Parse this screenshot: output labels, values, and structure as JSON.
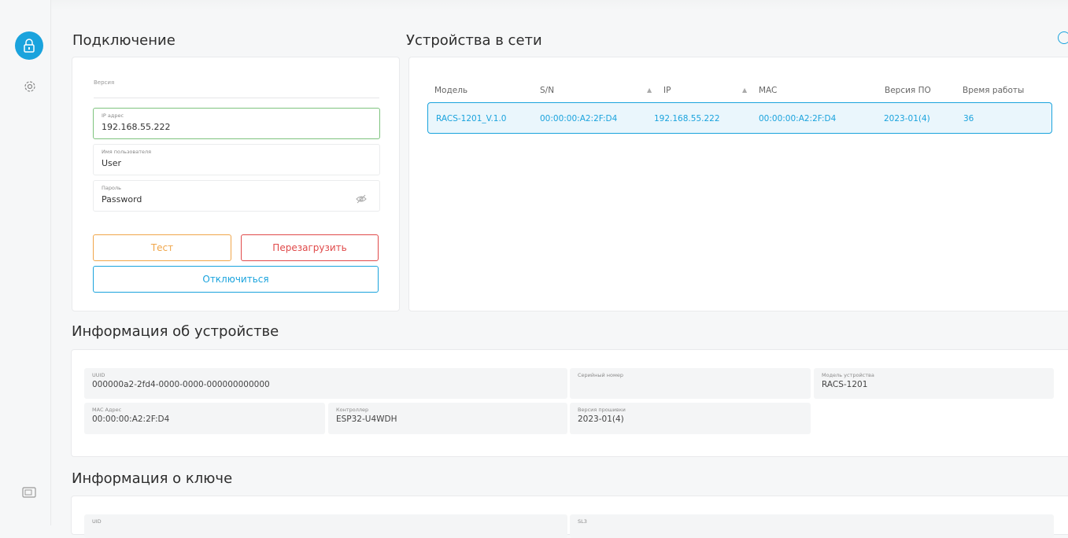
{
  "connection": {
    "title": "Подключение",
    "version_label": "Версия",
    "ip_label": "IP адрес",
    "ip_value": "192.168.55.222",
    "user_label": "Имя пользователя",
    "user_value": "User",
    "password_label": "Пароль",
    "password_value": "Password",
    "test_button": "Тест",
    "reboot_button": "Перезагрузить",
    "disconnect_button": "Отключиться"
  },
  "devices": {
    "title": "Устройства в сети",
    "columns": [
      "Модель",
      "S/N",
      "IP",
      "MAC",
      "Версия ПО",
      "Время работы"
    ],
    "rows": [
      [
        "RACS-1201_V.1.0",
        "00:00:00:A2:2F:D4",
        "192.168.55.222",
        "00:00:00:A2:2F:D4",
        "2023-01(4)",
        "36"
      ]
    ]
  },
  "device_info": {
    "title": "Информация об устройстве",
    "uuid_label": "UUID",
    "uuid_value": "000000a2-2fd4-0000-0000-000000000000",
    "serial_label": "Серийный номер",
    "serial_value": "",
    "model_label": "Модель устройства",
    "model_value": "RACS-1201",
    "mac_label": "MAC Адрес",
    "mac_value": "00:00:00:A2:2F:D4",
    "controller_label": "Контроллер",
    "controller_value": "ESP32-U4WDH",
    "firmware_label": "Версия прошивки",
    "firmware_value": "2023-01(4)"
  },
  "key_info": {
    "title": "Информация о ключе",
    "uid_label": "UID",
    "sl3_label": "SL3"
  },
  "colors": {
    "accent": "#1aa3dd",
    "success": "#7ec37e",
    "test_orange": "#f0a64a",
    "reboot_red": "#e04a4a"
  }
}
